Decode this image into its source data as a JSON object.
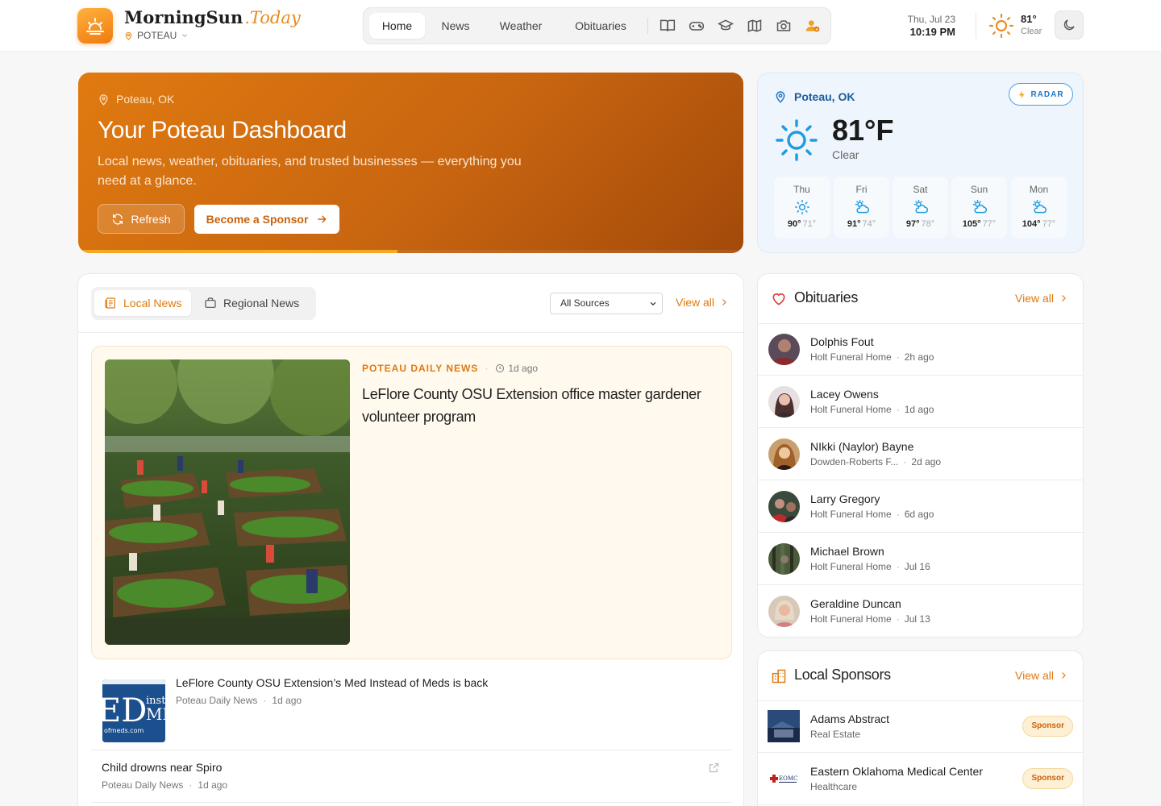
{
  "header": {
    "brand_main": "MorningSun",
    "brand_accent": ".Today",
    "location": "POTEAU",
    "nav_tabs": [
      {
        "label": "Home",
        "active": true
      },
      {
        "label": "News",
        "active": false
      },
      {
        "label": "Weather",
        "active": false
      },
      {
        "label": "Obituaries",
        "active": false
      }
    ],
    "nav_icons": [
      "book-icon",
      "gamepad-icon",
      "graduation-cap-icon",
      "map-icon",
      "camera-icon",
      "user-sponsor-icon"
    ],
    "date": "Thu, Jul 23",
    "time": "10:19 PM",
    "temp": "81°",
    "condition": "Clear"
  },
  "hero": {
    "location": "Poteau, OK",
    "title": "Your Poteau Dashboard",
    "subtitle": "Local news, weather, obituaries, and trusted businesses — everything you need at a glance.",
    "refresh_label": "Refresh",
    "sponsor_label": "Become a Sponsor",
    "progress": 0.48
  },
  "weather": {
    "location": "Poteau, OK",
    "radar_label": "RADAR",
    "temp": "81°F",
    "condition": "Clear",
    "forecast": [
      {
        "day": "Thu",
        "icon": "sun-icon",
        "high": "90°",
        "low": "71°"
      },
      {
        "day": "Fri",
        "icon": "partly-cloudy-icon",
        "high": "91°",
        "low": "74°"
      },
      {
        "day": "Sat",
        "icon": "partly-cloudy-icon",
        "high": "97°",
        "low": "78°"
      },
      {
        "day": "Sun",
        "icon": "partly-cloudy-icon",
        "high": "105°",
        "low": "77°"
      },
      {
        "day": "Mon",
        "icon": "partly-cloudy-icon",
        "high": "104°",
        "low": "77°"
      }
    ]
  },
  "news": {
    "tabs": [
      {
        "label": "Local News",
        "active": true
      },
      {
        "label": "Regional News",
        "active": false
      }
    ],
    "source_select": "All Sources",
    "view_all": "View all",
    "featured": {
      "source": "POTEAU DAILY NEWS",
      "time": "1d ago",
      "title": "LeFlore County OSU Extension office master gardener volunteer program"
    },
    "articles": [
      {
        "title": "LeFlore County OSU Extension’s Med Instead of Meds is back",
        "source": "Poteau Daily News",
        "time": "1d ago",
        "thumb_text": "ED",
        "thumb_text2": "inst",
        "thumb_text3": "MI",
        "thumb_url": "ofmeds.com"
      },
      {
        "title": "Child drowns near Spiro",
        "source": "Poteau Daily News",
        "time": "1d ago"
      }
    ]
  },
  "obituaries": {
    "title": "Obituaries",
    "view_all": "View all",
    "items": [
      {
        "name": "Dolphis Fout",
        "home": "Holt Funeral Home",
        "time": "2h ago"
      },
      {
        "name": "Lacey Owens",
        "home": "Holt Funeral Home",
        "time": "1d ago"
      },
      {
        "name": "NIkki (Naylor) Bayne",
        "home": "Dowden-Roberts F...",
        "time": "2d ago"
      },
      {
        "name": "Larry Gregory",
        "home": "Holt Funeral Home",
        "time": "6d ago"
      },
      {
        "name": "Michael Brown",
        "home": "Holt Funeral Home",
        "time": "Jul 16"
      },
      {
        "name": "Geraldine Duncan",
        "home": "Holt Funeral Home",
        "time": "Jul 13"
      }
    ]
  },
  "sponsors": {
    "title": "Local Sponsors",
    "view_all": "View all",
    "items": [
      {
        "name": "Adams Abstract",
        "category": "Real Estate",
        "badge": "Sponsor"
      },
      {
        "name": "Eastern Oklahoma Medical Center",
        "category": "Healthcare",
        "badge": "Sponsor",
        "logo_text": "EOMC"
      }
    ]
  },
  "colors": {
    "accent": "#e07a10",
    "weather_blue": "#1e78c8",
    "obit_heart": "#e03a3a"
  }
}
